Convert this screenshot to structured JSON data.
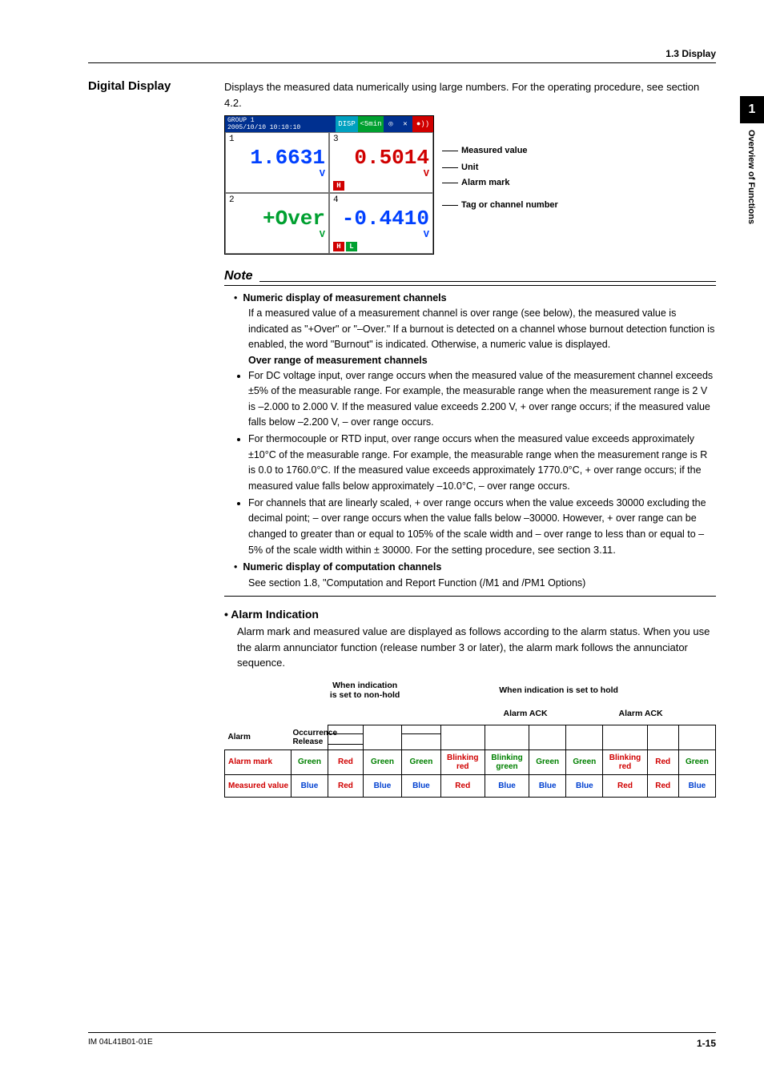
{
  "header": {
    "section": "1.3  Display"
  },
  "sidebar": {
    "chapter": "1",
    "title": "Overview of Functions"
  },
  "section": {
    "title": "Digital Display",
    "intro": "Displays the measured data numerically using large numbers. For the operating procedure, see section 4.2."
  },
  "screen": {
    "status": {
      "group": "GROUP 1",
      "datetime": "2005/10/10 10:10:10",
      "disp": "DISP",
      "mode": "<5min",
      "iconA": "◎",
      "iconB": "✕",
      "rec": "●))"
    },
    "cells": [
      {
        "ch": "1",
        "value": "1.6631",
        "unit": "V",
        "color": "blue",
        "alarms": []
      },
      {
        "ch": "3",
        "value": "0.5014",
        "unit": "V",
        "color": "red",
        "alarms": [
          {
            "t": "H",
            "c": "bg-red"
          }
        ]
      },
      {
        "ch": "2",
        "value": "+Over",
        "unit": "V",
        "color": "green",
        "alarms": []
      },
      {
        "ch": "4",
        "value": "-0.4410",
        "unit": "V",
        "color": "blue",
        "alarms": [
          {
            "t": "H",
            "c": "bg-red"
          },
          {
            "t": "L",
            "c": "bg-green"
          }
        ]
      }
    ],
    "callouts": {
      "measured": "Measured value",
      "unit": "Unit",
      "alarm": "Alarm mark",
      "tag": "Tag or channel number"
    }
  },
  "note": {
    "title": "Note",
    "h1": "Numeric display of measurement channels",
    "p1": "If a measured value of a measurement channel is over range (see below), the measured value is indicated as \"+Over\" or \"–Over.\" If a burnout is detected on a channel whose burnout detection function is enabled, the word \"Burnout\" is indicated. Otherwise, a numeric value is displayed.",
    "h2": "Over range of measurement channels",
    "b1": "For DC voltage input, over range occurs when the measured value of the measurement channel exceeds ±5% of the measurable range. For example, the measurable range when the measurement range is 2 V is –2.000 to 2.000 V. If the measured value exceeds 2.200 V, + over range occurs; if the measured value falls below –2.200 V, – over range occurs.",
    "b2": "For thermocouple or RTD input, over range occurs when the measured value exceeds approximately ±10°C of the measurable range. For example, the measurable range when the measurement range is R is 0.0 to 1760.0°C. If the measured value exceeds approximately 1770.0°C, + over range occurs; if the measured value falls below approximately –10.0°C, – over range occurs.",
    "b3a": "For channels that are linearly scaled, + over range occurs when the value exceeds 30000 excluding the decimal point; – over range occurs when the value falls below –30000. However, + over range can be changed to greater than or equal to 105% of the scale width and – over range to less than or equal to –5% of the scale width within ± 30000. ",
    "b3b": "For the setting procedure, see section 3.11.",
    "h3": "Numeric display of computation channels",
    "p3": "See section 1.8, \"Computation and Report Function (/M1 and /PM1 Options)"
  },
  "alarm_section": {
    "bullet": "•  Alarm Indication",
    "para": "Alarm mark and measured value are displayed as follows according to the alarm status. When you use the alarm annunciator function (release number 3 or later), the alarm mark follows the annunciator sequence."
  },
  "alarm_table": {
    "group_nonhold": "When indication is set to non-hold",
    "group_hold": "When indication is set to hold",
    "ack1": "Alarm ACK",
    "ack2": "Alarm ACK",
    "row_alarm": "Alarm",
    "occurrence": "Occurrence",
    "release": "Release",
    "row_mark": "Alarm mark",
    "row_value": "Measured value",
    "cells_mark": [
      "Green",
      "Red",
      "Green",
      "Green",
      "Blinking red",
      "Blinking green",
      "Green",
      "Green",
      "Blinking red",
      "Red",
      "Green"
    ],
    "cells_value": [
      "Blue",
      "Red",
      "Blue",
      "Blue",
      "Red",
      "Blue",
      "Blue",
      "Blue",
      "Red",
      "Red",
      "Blue"
    ]
  },
  "footer": {
    "doc": "IM 04L41B01-01E",
    "page": "1-15"
  }
}
